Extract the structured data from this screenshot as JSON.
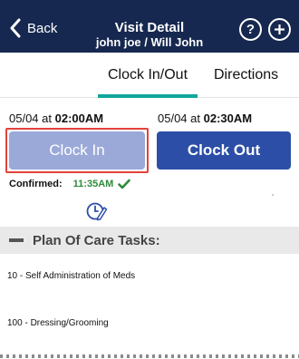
{
  "header": {
    "back_label": "Back",
    "title": "Visit Detail",
    "subtitle": "john joe / Will John",
    "help_symbol": "?"
  },
  "tabs": [
    {
      "label": "Clock In/Out",
      "active": true
    },
    {
      "label": "Directions",
      "active": false
    }
  ],
  "clock_in": {
    "date": "05/04 at ",
    "time": "02:00AM",
    "button_label": "Clock In"
  },
  "clock_out": {
    "date": "05/04 at ",
    "time": "02:30AM",
    "button_label": "Clock Out"
  },
  "confirmation": {
    "label": "Confirmed:",
    "time": "11:35AM"
  },
  "plan_of_care": {
    "title": "Plan Of Care Tasks:",
    "tasks": [
      "10 - Self Administration of Meds",
      "100 - Dressing/Grooming"
    ]
  },
  "colors": {
    "header_bg": "#16284f",
    "tab_accent": "#11a79a",
    "clock_in_button": "#9ba9d9",
    "clock_out_button": "#2c4ea6",
    "highlight_border": "#e2433b",
    "confirmed_green": "#2e8b3a"
  }
}
